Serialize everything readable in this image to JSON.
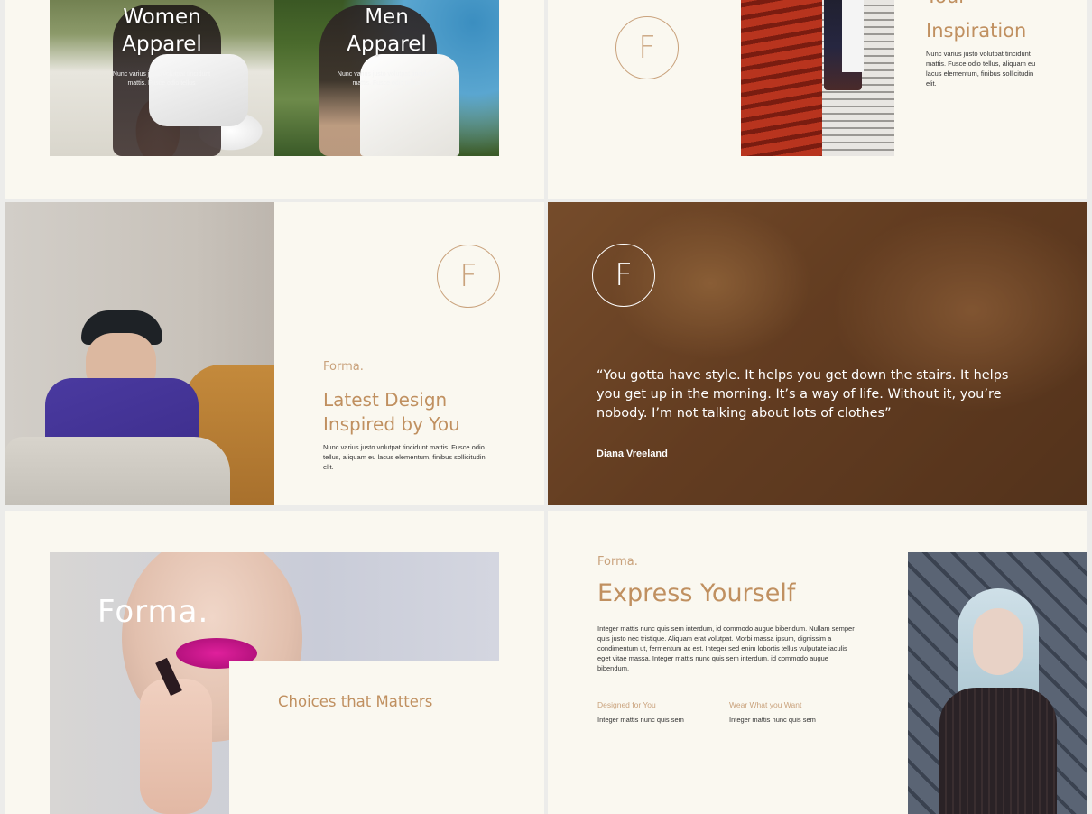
{
  "slide1": {
    "women_title_1": "Women",
    "women_title_2": "Apparel",
    "women_desc": "Nunc varius justo volutpat tincidunt mattis. Fusce odio tellus",
    "men_title_1": "Men",
    "men_title_2": "Apparel",
    "men_desc": "Nunc varius justo volutpat tincidunt mattis. Fusce odio tellus"
  },
  "slide2": {
    "logo_letter": "F",
    "heading_1": "Your",
    "heading_2": "Inspiration",
    "body": "Nunc varius justo volutpat tincidunt mattis. Fusce odio tellus, aliquam eu lacus elementum, finibus sollicitudin elit."
  },
  "slide3": {
    "logo_letter": "F",
    "brand": "Forma.",
    "heading_1": "Latest Design",
    "heading_2": "Inspired by You",
    "body": "Nunc varius justo volutpat tincidunt mattis. Fusce odio tellus, aliquam eu lacus elementum, finibus sollicitudin elit."
  },
  "slide4": {
    "logo_letter": "F",
    "quote": "“You gotta have style. It helps you get down the stairs. It helps you get up in the morning. It’s a way of life. Without it, you’re nobody. I’m not talking about lots of clothes”",
    "author": "Diana Vreeland"
  },
  "slide5": {
    "overlay_title": "Forma.",
    "heading": "Choices that Matters"
  },
  "slide6": {
    "brand": "Forma.",
    "heading": "Express Yourself",
    "body": "Integer mattis nunc quis sem interdum, id commodo augue bibendum. Nullam semper quis justo nec tristique. Aliquam erat volutpat. Morbi massa ipsum, dignissim a condimentum ut, fermentum ac est. Integer sed enim lobortis tellus vulputate iaculis eget vitae massa. Integer mattis nunc quis sem interdum, id commodo augue bibendum.",
    "col1_title": "Designed for You",
    "col1_body": "Integer mattis nunc quis sem",
    "col2_title": "Wear What you Want",
    "col2_body": "Integer mattis nunc quis sem"
  },
  "colors": {
    "slide_bg": "#faf8f0",
    "accent": "#c9a27c",
    "page_bg": "#ececea",
    "quote_overlay": "#5a3a22"
  }
}
